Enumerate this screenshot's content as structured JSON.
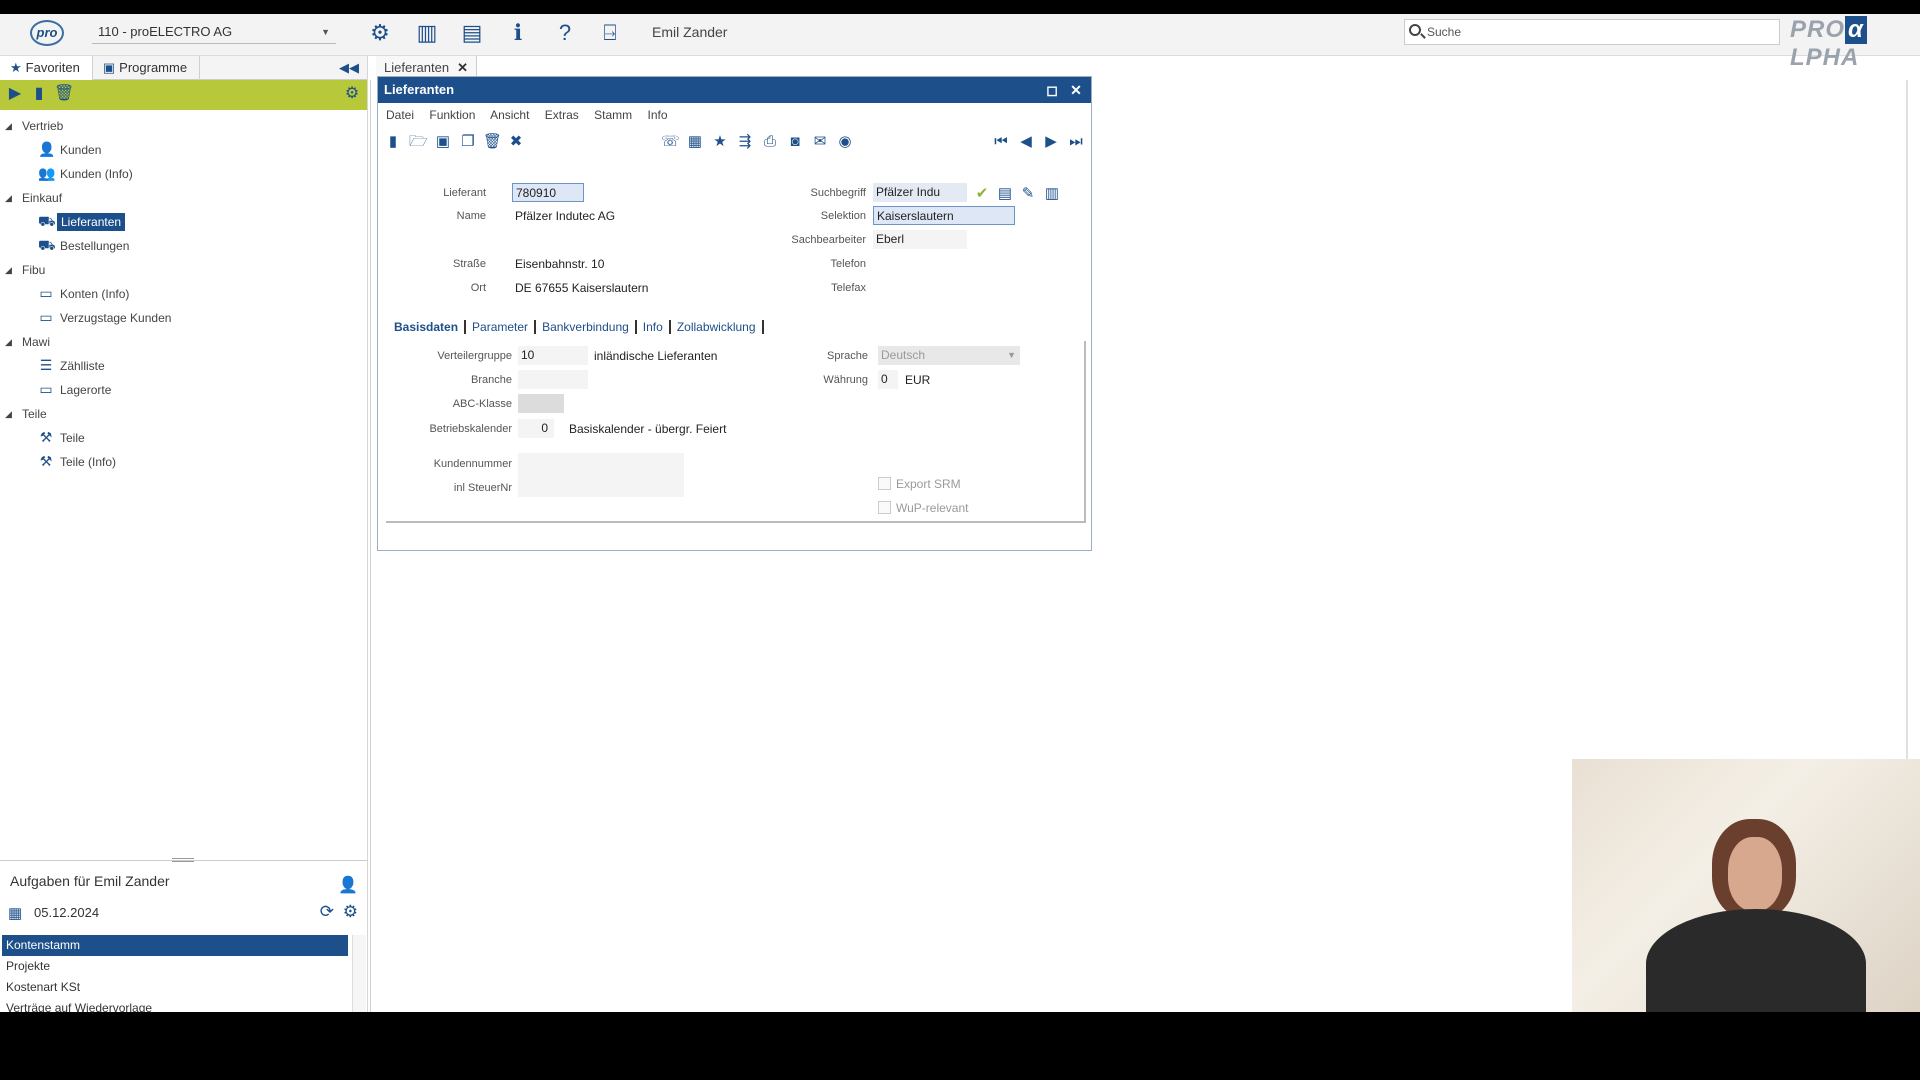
{
  "topbar": {
    "logo": "pro",
    "company": "110 - proELECTRO AG",
    "user": "Emil Zander",
    "search_placeholder": "Suche",
    "brand_left": "PRO",
    "brand_alpha": "α",
    "brand_right": "LPHA"
  },
  "left": {
    "tabs": [
      "Favoriten",
      "Programme"
    ],
    "tree": [
      {
        "type": "group",
        "label": "Vertrieb"
      },
      {
        "type": "leaf",
        "label": "Kunden",
        "icon": "person-icon"
      },
      {
        "type": "leaf",
        "label": "Kunden (Info)",
        "icon": "person-info-icon"
      },
      {
        "type": "group",
        "label": "Einkauf"
      },
      {
        "type": "leaf",
        "label": "Lieferanten",
        "icon": "truck-icon",
        "selected": true
      },
      {
        "type": "leaf",
        "label": "Bestellungen",
        "icon": "order-icon"
      },
      {
        "type": "group",
        "label": "Fibu"
      },
      {
        "type": "leaf",
        "label": "Konten (Info)",
        "icon": "window-icon"
      },
      {
        "type": "leaf",
        "label": "Verzugstage Kunden",
        "icon": "window-icon"
      },
      {
        "type": "group",
        "label": "Mawi"
      },
      {
        "type": "leaf",
        "label": "Zählliste",
        "icon": "list-icon"
      },
      {
        "type": "leaf",
        "label": "Lagerorte",
        "icon": "window-icon"
      },
      {
        "type": "group",
        "label": "Teile"
      },
      {
        "type": "leaf",
        "label": "Teile",
        "icon": "parts-icon"
      },
      {
        "type": "leaf",
        "label": "Teile (Info)",
        "icon": "parts-icon"
      }
    ],
    "tasks_title": "Aufgaben für Emil Zander",
    "tasks_date": "05.12.2024",
    "task_items": [
      "Kontenstamm",
      "Projekte",
      "Kostenart KSt",
      "Verträge auf Wiedervorlage"
    ]
  },
  "main_tab": "Lieferanten",
  "window": {
    "title": "Lieferanten",
    "menu": [
      "Datei",
      "Funktion",
      "Ansicht",
      "Extras",
      "Stamm",
      "Info"
    ],
    "labels": {
      "lieferant": "Lieferant",
      "name": "Name",
      "strasse": "Straße",
      "ort": "Ort",
      "suchbegriff": "Suchbegriff",
      "selektion": "Selektion",
      "sachbearbeiter": "Sachbearbeiter",
      "telefon": "Telefon",
      "telefax": "Telefax"
    },
    "values": {
      "lieferant": "780910",
      "name": "Pfälzer Indutec AG",
      "strasse": "Eisenbahnstr. 10",
      "ort": "DE 67655 Kaiserslautern",
      "suchbegriff": "Pfälzer Indu",
      "selektion": "Kaiserslautern",
      "sachbearbeiter": "Eberl"
    },
    "subtabs": [
      "Basisdaten",
      "Parameter",
      "Bankverbindung",
      "Info",
      "Zollabwicklung"
    ],
    "basis": {
      "verteilergruppe_label": "Verteilergruppe",
      "verteilergruppe_value": "10",
      "verteilergruppe_text": "inländische Lieferanten",
      "branche_label": "Branche",
      "abc_label": "ABC-Klasse",
      "betriebskalender_label": "Betriebskalender",
      "betriebskalender_value": "0",
      "betriebskalender_text": "Basiskalender - übergr. Feiert",
      "kundennummer_label": "Kundennummer",
      "steuernr_label": "inl SteuerNr",
      "sprache_label": "Sprache",
      "sprache_value": "Deutsch",
      "waehrung_label": "Währung",
      "waehrung_value": "0",
      "waehrung_text": "EUR",
      "export_srm": "Export SRM",
      "wup": "WuP-relevant"
    }
  }
}
